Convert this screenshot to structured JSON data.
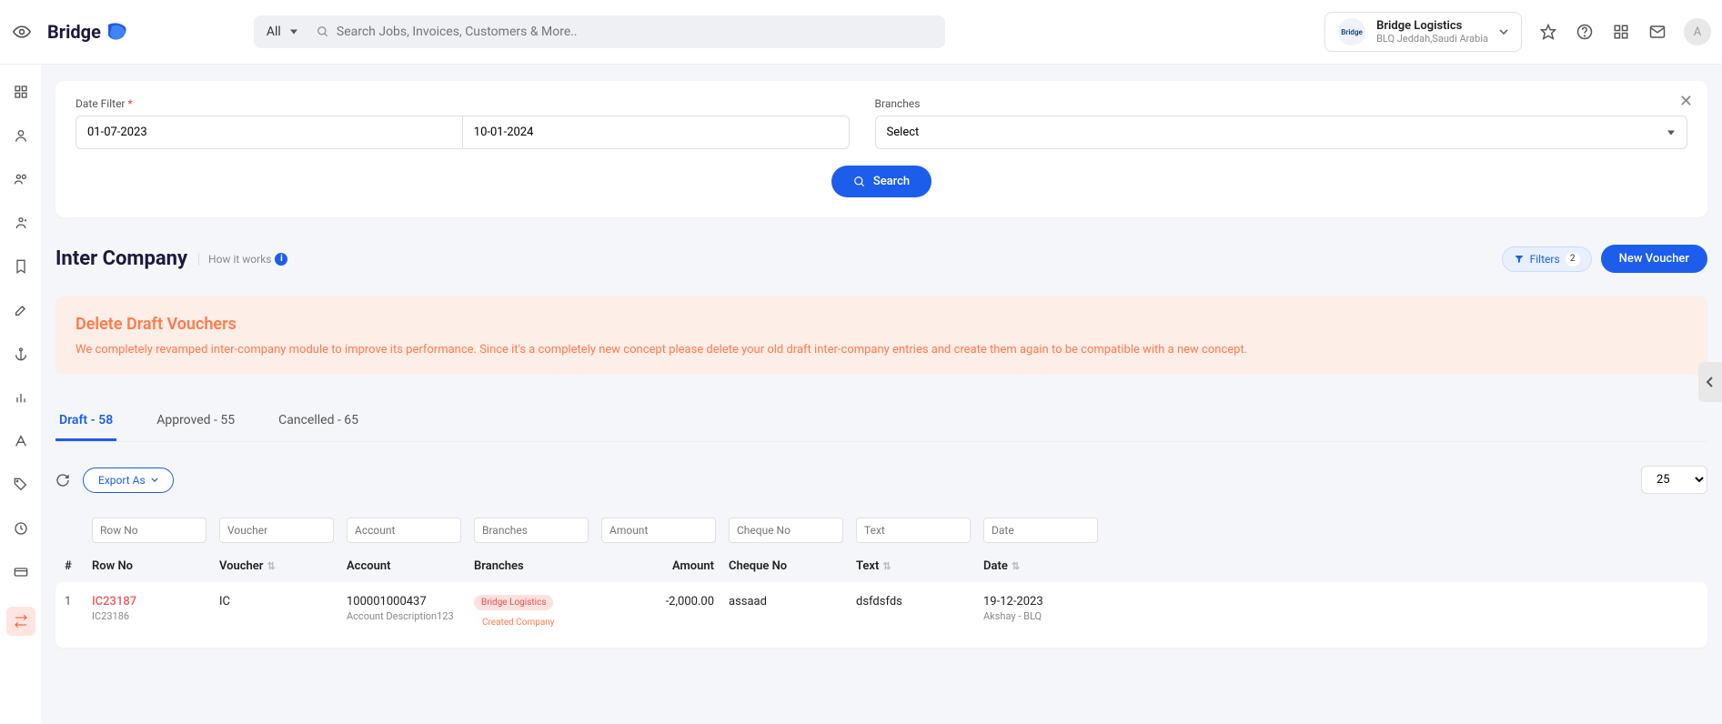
{
  "header": {
    "logo_text": "Bridge",
    "search_scope": "All",
    "search_placeholder": "Search Jobs, Invoices, Customers & More..",
    "company_name": "Bridge Logistics",
    "company_location": "BLQ Jeddah,Saudi Arabia",
    "avatar_initial": "A"
  },
  "filters": {
    "date_label": "Date Filter",
    "date_from": "01-07-2023",
    "date_to": "10-01-2024",
    "branches_label": "Branches",
    "branches_value": "Select",
    "search_btn": "Search"
  },
  "page": {
    "title": "Inter Company",
    "how_it_works": "How it works",
    "filters_label": "Filters",
    "filters_count": "2",
    "new_voucher": "New Voucher"
  },
  "alert": {
    "title": "Delete Draft Vouchers",
    "body": "We completely revamped inter-company module to improve its performance. Since it's a completely new concept please delete your old draft inter-company entries and create them again to be compatible with a new concept."
  },
  "tabs": {
    "draft": "Draft - 58",
    "approved": "Approved - 55",
    "cancelled": "Cancelled - 65"
  },
  "toolbar": {
    "export": "Export As",
    "page_size": "25"
  },
  "table": {
    "filters": {
      "row_no": "Row No",
      "voucher": "Voucher",
      "account": "Account",
      "branches": "Branches",
      "amount": "Amount",
      "cheque": "Cheque No",
      "text": "Text",
      "date": "Date"
    },
    "headers": {
      "idx": "#",
      "row_no": "Row No",
      "voucher": "Voucher",
      "account": "Account",
      "branches": "Branches",
      "amount": "Amount",
      "cheque": "Cheque No",
      "text": "Text",
      "date": "Date"
    },
    "row": {
      "idx": "1",
      "row_no": "IC23187",
      "row_no_sub": "IC23186",
      "voucher": "IC",
      "account": "100001000437",
      "account_desc": "Account Description123",
      "branch_badge1": "Bridge Logistics",
      "branch_badge2": "Created Company",
      "amount": "-2,000.00",
      "cheque": "assaad",
      "text": "dsfdsfds",
      "date": "19-12-2023",
      "date_sub": "Akshay - BLQ"
    }
  }
}
